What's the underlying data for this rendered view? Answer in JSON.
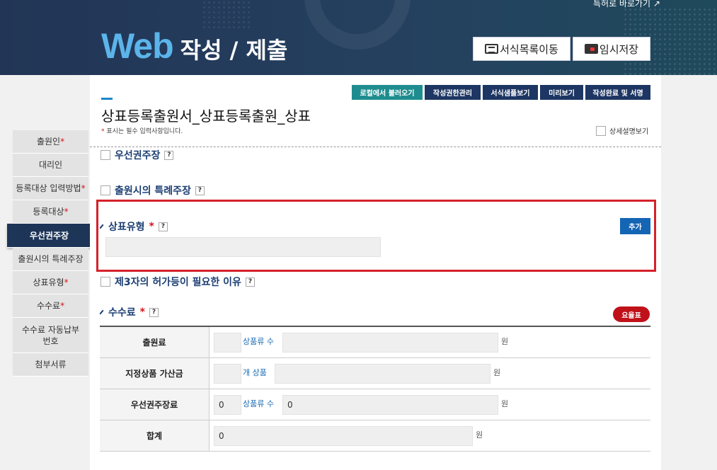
{
  "header": {
    "shortcut": "특허로 바로가기 ↗",
    "brand_web": "Web",
    "brand_title": "작성 / 제출",
    "form_list_btn": "서식목록이동",
    "temp_save_btn": "임시저장"
  },
  "toolbar": {
    "load_local": "로컬에서 불러오기",
    "auth_manage": "작성권한관리",
    "sample_view": "서식샘플보기",
    "preview": "미리보기",
    "complete_sign": "작성완료 및 서명"
  },
  "form": {
    "title": "상표등록출원서_상표등록출원_상표",
    "required_note": "표시는 필수 입력사항입니다.",
    "required_star": "*",
    "detail_view": "상세설명보기"
  },
  "sidebar": {
    "items": [
      {
        "label": "출원인",
        "req": "*"
      },
      {
        "label": "대리인",
        "req": ""
      },
      {
        "label": "등록대상 입력방법",
        "req": "*"
      },
      {
        "label": "등록대상",
        "req": "*"
      },
      {
        "label": "우선권주장",
        "req": ""
      },
      {
        "label": "출원시의 특례주장",
        "req": ""
      },
      {
        "label": "상표유형",
        "req": "*"
      },
      {
        "label": "수수료",
        "req": "*"
      },
      {
        "label": "수수료 자동납부번호",
        "req": ""
      },
      {
        "label": "첨부서류",
        "req": ""
      }
    ]
  },
  "sections": {
    "priority": "우선권주장",
    "special": "출원시의 특례주장",
    "mark_type": "상표유형",
    "third_party": "제3자의 허가등이 필요한 이유",
    "fee": "수수료",
    "star": "*",
    "help": "?",
    "add_btn": "추가",
    "rate_btn": "요율표"
  },
  "fee_table": {
    "rows": [
      {
        "label": "출원료",
        "first": "",
        "unit": "상품류 수",
        "second": "",
        "won": "원"
      },
      {
        "label": "지정상품 가산금",
        "first": "",
        "unit": "개 상품",
        "second": "",
        "won": "원"
      },
      {
        "label": "우선권주장료",
        "first": "0",
        "unit": "상품류 수",
        "second": "0",
        "won": "원"
      },
      {
        "label": "합계",
        "first": "0",
        "won": "원"
      }
    ]
  }
}
